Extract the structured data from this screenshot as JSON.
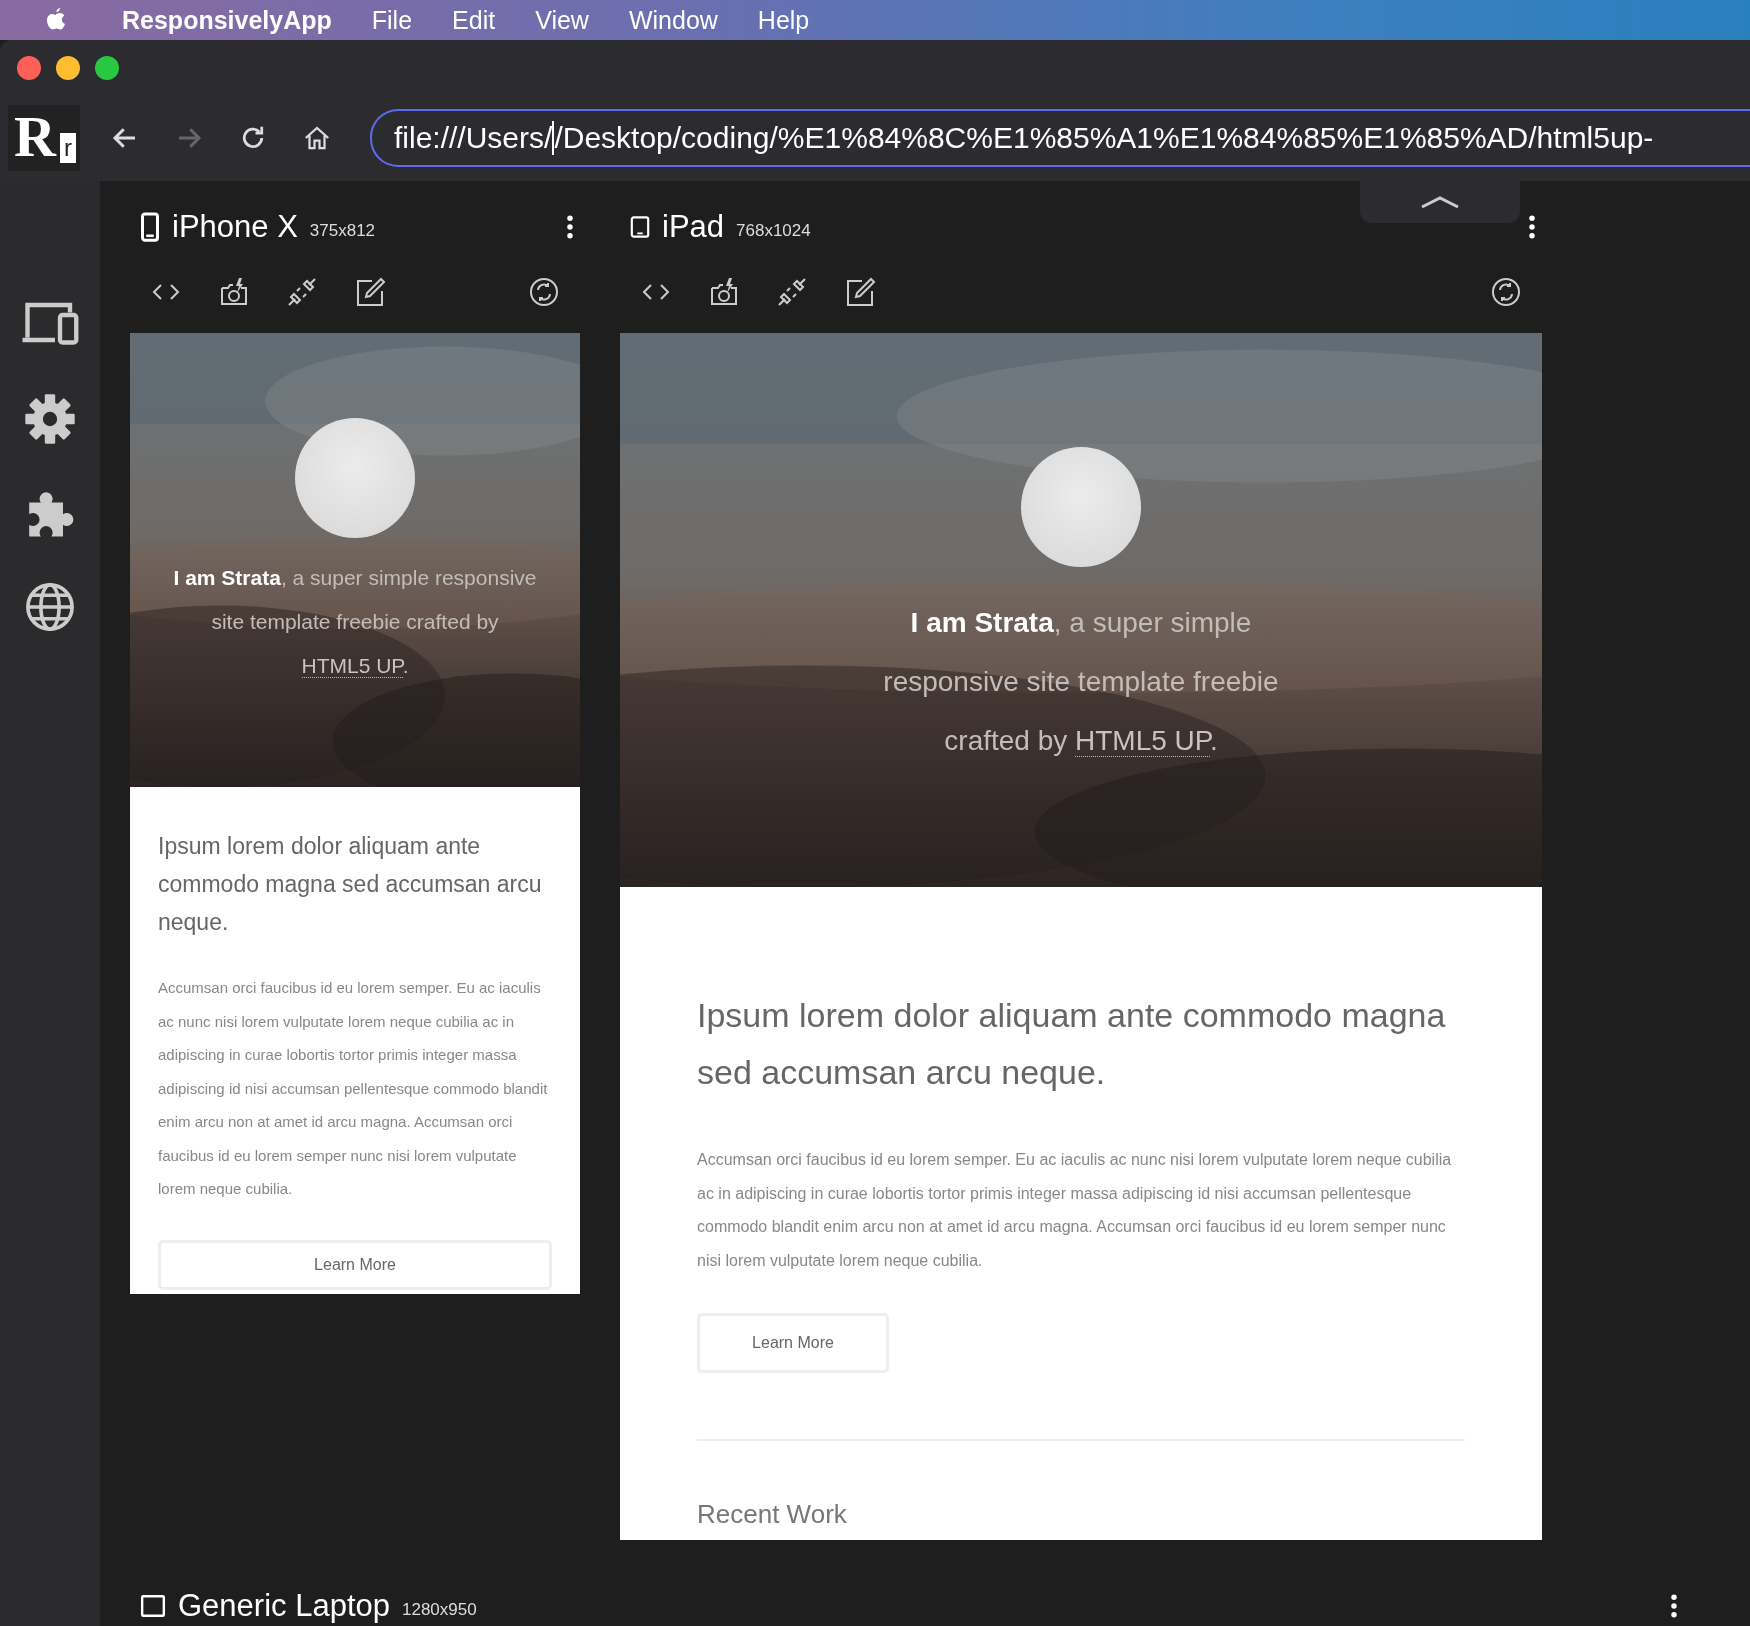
{
  "menubar": {
    "app_name": "ResponsivelyApp",
    "menus": [
      "File",
      "Edit",
      "View",
      "Window",
      "Help"
    ]
  },
  "logo": {
    "letter": "R",
    "sub": "r"
  },
  "address_bar": {
    "before_cursor": "file:///Users/",
    "after_cursor": "/Desktop/coding/%E1%84%8C%E1%85%A1%E1%84%85%E1%85%AD/html5up-"
  },
  "devices": [
    {
      "kind": "phone",
      "name": "iPhone X",
      "resolution": "375x812",
      "hero_lead": "**I am Strata**, a super simple responsive site template freebie crafted by",
      "hero_link": "HTML5 UP",
      "hero_end": ".",
      "heading": "Ipsum lorem dolor aliquam ante commodo magna sed accumsan arcu neque.",
      "body": "Accumsan orci faucibus id eu lorem semper. Eu ac iaculis ac nunc nisi lorem vulputate lorem neque cubilia ac in adipiscing in curae lobortis tortor primis integer massa adipiscing id nisi accumsan pellentesque commodo blandit enim arcu non at amet id arcu magna. Accumsan orci faucibus id eu lorem semper nunc nisi lorem vulputate lorem neque cubilia.",
      "button": "Learn More"
    },
    {
      "kind": "tablet",
      "name": "iPad",
      "resolution": "768x1024",
      "hero_lead": "**I am Strata**, a super simple responsive site template freebie crafted by",
      "hero_link": "HTML5 UP",
      "hero_end": ".",
      "heading": "Ipsum lorem dolor aliquam ante commodo magna sed accumsan arcu neque.",
      "body": "Accumsan orci faucibus id eu lorem semper. Eu ac iaculis ac nunc nisi lorem vulputate lorem neque cubilia ac in adipiscing in curae lobortis tortor primis integer massa adipiscing id nisi accumsan pellentesque commodo blandit enim arcu non at amet id arcu magna. Accumsan orci faucibus id eu lorem semper nunc nisi lorem vulputate lorem neque cubilia.",
      "button": "Learn More",
      "section_heading": "Recent Work"
    }
  ],
  "more_devices": [
    {
      "kind": "laptop",
      "name": "Generic Laptop",
      "resolution": "1280x950"
    }
  ]
}
